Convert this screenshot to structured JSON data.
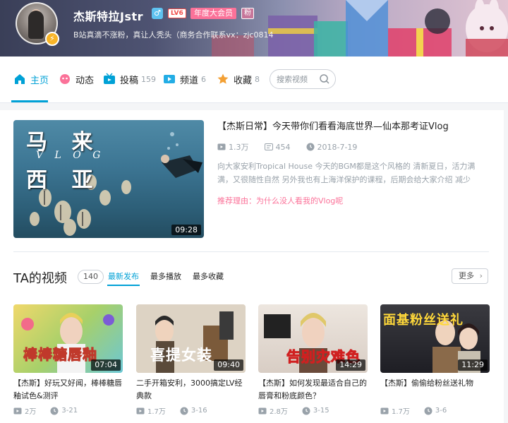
{
  "header": {
    "username": "杰斯特拉Jstr",
    "gender_symbol": "♂",
    "level": "LV6",
    "vip_label": "年度大会员",
    "fan_label": "粉",
    "sign": "B站真滴不涨粉，真让人秃头（商务合作联系vx：zjc0814"
  },
  "nav": {
    "items": [
      {
        "label": "主页",
        "count": ""
      },
      {
        "label": "动态",
        "count": ""
      },
      {
        "label": "投稿",
        "count": "159"
      },
      {
        "label": "频道",
        "count": "6"
      },
      {
        "label": "收藏",
        "count": "8"
      }
    ],
    "search_placeholder": "搜索视频"
  },
  "featured": {
    "title": "【杰斯日常】今天带你们看看海底世界—仙本那考证Vlog",
    "views": "1.3万",
    "danmaku": "454",
    "date": "2018-7-19",
    "description": "向大家安利Tropical House 今天的BGM都是这个风格的 清新夏日，活力满满，又很随性自然 另外我也有上海洋保护的课程，后期会给大家介绍 减少",
    "reason": "推荐理由：为什么没人看我的Vlog呢",
    "duration": "09:28",
    "overlay_line1": "马 来",
    "overlay_vlog": "V L O G",
    "overlay_line2": "西 亚"
  },
  "videos_section": {
    "title": "TA的视频",
    "count": "140",
    "tabs": [
      "最新发布",
      "最多播放",
      "最多收藏"
    ],
    "more_label": "更多",
    "items": [
      {
        "title": "【杰斯】好玩又好闻，棒棒糖唇釉试色&测评",
        "duration": "07:04",
        "views": "2万",
        "date": "3-21",
        "overlay": "棒棒糖唇釉"
      },
      {
        "title": "二手开箱安利，3000搞定LV经典款",
        "duration": "09:40",
        "views": "1.7万",
        "date": "3-16",
        "overlay": "喜提女装"
      },
      {
        "title": "【杰斯】如何发现最适合自己的唇膏和粉底颜色？",
        "duration": "14:29",
        "views": "2.8万",
        "date": "3-15",
        "overlay": "告别灾难色"
      },
      {
        "title": "【杰斯】偷偷给粉丝送礼物",
        "duration": "11:29",
        "views": "1.7万",
        "date": "3-6",
        "overlay": "面基粉丝送礼"
      }
    ]
  },
  "colors": {
    "accent": "#00a1d6",
    "pink": "#fb7299",
    "meta_gray": "#99a2aa"
  }
}
